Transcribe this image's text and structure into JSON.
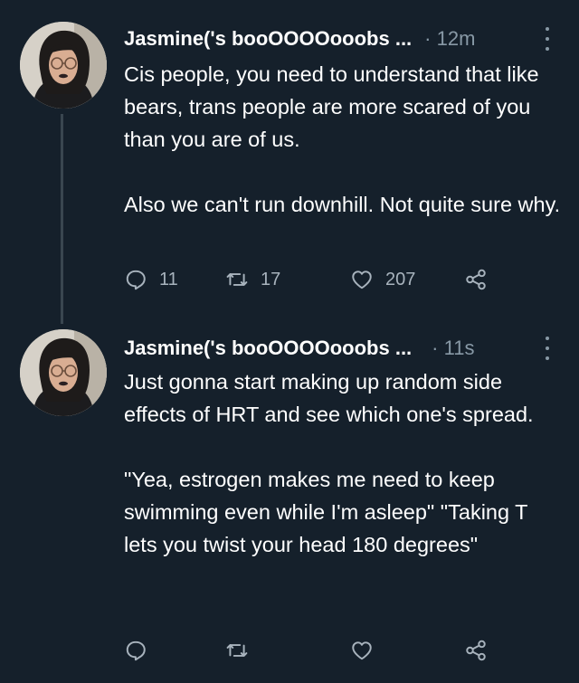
{
  "tweets": [
    {
      "author": "Jasmine('s booOOOOooobs ...",
      "time": "· 12m",
      "paragraphs": [
        "Cis people, you need to understand that like bears, trans people are more scared of you than you are of us.",
        "Also we can't run downhill. Not quite sure why."
      ],
      "replies": "11",
      "retweets": "17",
      "likes": "207",
      "icons": [
        "reply-icon",
        "retweet-icon",
        "like-icon",
        "share-icon",
        "more-icon"
      ]
    },
    {
      "author": "Jasmine('s booOOOOooobs ...",
      "time": "· 11s",
      "paragraphs": [
        "Just gonna start making up random side effects of HRT and see which one's spread.",
        "\"Yea, estrogen makes me need to keep swimming even while I'm asleep\" \"Taking T lets you twist your head 180 degrees\""
      ],
      "replies": "",
      "retweets": "",
      "likes": "",
      "icons": [
        "reply-icon",
        "retweet-icon",
        "like-icon",
        "share-icon",
        "more-icon"
      ]
    }
  ],
  "colors": {
    "background": "#15202b",
    "text": "#ffffff",
    "secondary": "#8899a6",
    "thread_line": "#3a4650"
  }
}
